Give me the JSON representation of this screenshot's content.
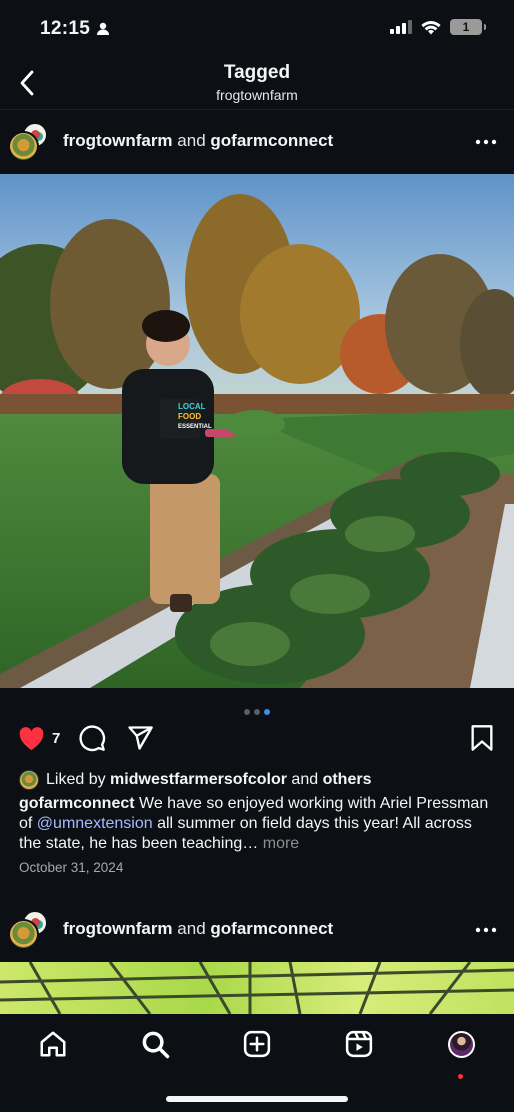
{
  "status_bar": {
    "time": "12:15",
    "battery": "1"
  },
  "header": {
    "title": "Tagged",
    "subtitle": "frogtownfarm"
  },
  "posts": [
    {
      "user1": "frogtownfarm",
      "and": "and",
      "user2": "gofarmconnect",
      "likes_count": "7",
      "liked_by_prefix": "Liked by ",
      "liked_by_user": "midwestfarmersofcolor",
      "liked_by_and": " and ",
      "liked_by_others": "others",
      "caption_user": "gofarmconnect",
      "caption_part1": " We have so enjoyed working with Ariel Pressman of ",
      "caption_mention": "@umnextension",
      "caption_part2": " all summer on field days this year! All across the state, he has been teaching… ",
      "caption_more": "more",
      "date": "October 31, 2024",
      "carousel": {
        "count": 3,
        "active_index": 2
      },
      "shirt_text": [
        "LOCAL",
        "FOOD",
        "ESSENTIAL"
      ]
    },
    {
      "user1": "frogtownfarm",
      "and": "and",
      "user2": "gofarmconnect"
    }
  ],
  "icons": {
    "back": "chevron-left-icon",
    "more": "more-horizontal-icon",
    "like": "heart-filled-icon",
    "comment": "comment-icon",
    "share": "send-icon",
    "save": "bookmark-icon",
    "tabs": [
      "home-icon",
      "search-icon",
      "create-icon",
      "reels-icon",
      "profile-avatar"
    ]
  },
  "colors": {
    "background": "#0c1014",
    "like": "#ff3040",
    "mention": "#a8b8ff",
    "carousel_active": "#3b8ef0"
  }
}
